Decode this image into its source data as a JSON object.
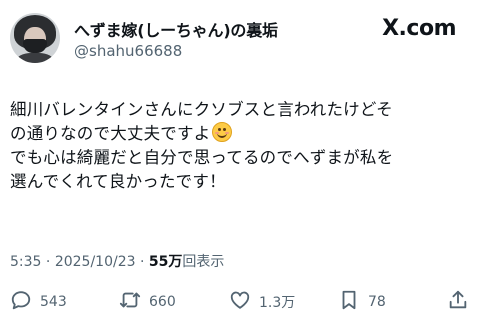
{
  "author": {
    "display_name": "へずま嫁(しーちゃん)の裏垢",
    "handle": "@shahu66688"
  },
  "brand": "X.com",
  "tweet": {
    "lines": [
      "細川バレンタインさんにクソブスと言われたけどそ",
      "の通りなので大丈夫ですよ",
      "でも心は綺麗だと自分で思ってるのでへずまが私を",
      "選んでくれて良かったです！"
    ],
    "emoji": "smiling-face-icon"
  },
  "meta": {
    "time": "5:35",
    "separator": "·",
    "date": "2025/10/23",
    "views_count": "55万",
    "views_label": "回表示"
  },
  "actions": {
    "replies": "543",
    "reposts": "660",
    "likes": "1.3万",
    "bookmarks": "78"
  },
  "colors": {
    "text": "#0f1419",
    "secondary": "#536471"
  }
}
